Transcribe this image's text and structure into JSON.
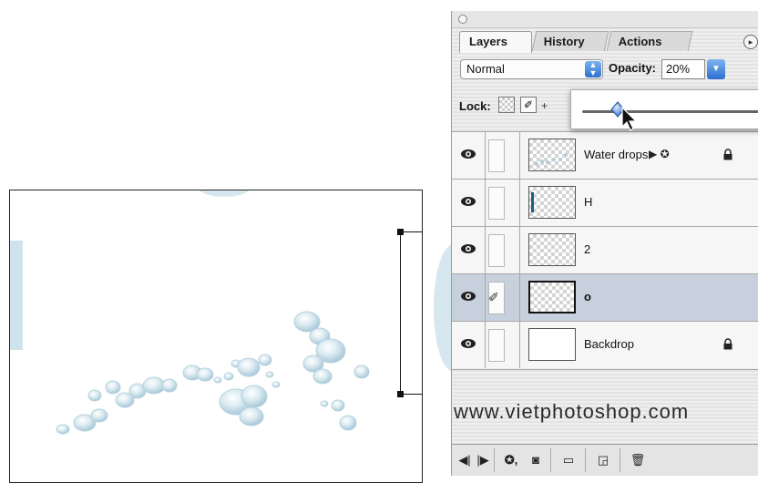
{
  "canvas": {
    "description_icon": "water-drops-artwork"
  },
  "panel": {
    "tabs": [
      {
        "label": "Layers",
        "active": true
      },
      {
        "label": "History",
        "active": false
      },
      {
        "label": "Actions",
        "active": false
      }
    ],
    "menu_icon": "▸",
    "blend_mode": "Normal",
    "opacity_label": "Opacity:",
    "opacity_value": "20%",
    "opacity_fraction": 0.2,
    "lock_label": "Lock:",
    "layers": [
      {
        "name": "Water drops",
        "badges": "▶ ✪",
        "locked": true,
        "selected": false,
        "thumb": "drops"
      },
      {
        "name": "H",
        "badges": "",
        "locked": false,
        "selected": false,
        "thumb": "transparent-mark"
      },
      {
        "name": "2",
        "badges": "",
        "locked": false,
        "selected": false,
        "thumb": "transparent"
      },
      {
        "name": "o",
        "badges": "",
        "locked": false,
        "selected": true,
        "thumb": "transparent"
      },
      {
        "name": "Backdrop",
        "badges": "",
        "locked": true,
        "selected": false,
        "thumb": "white"
      }
    ],
    "watermark": "www.vietphotoshop.com"
  },
  "colors": {
    "drop_fill": "#c5dde8",
    "selected_row": "#c7d1dd",
    "aqua_blue": "#2d6fd0"
  }
}
